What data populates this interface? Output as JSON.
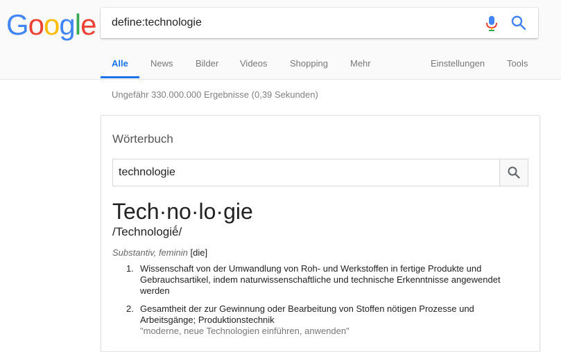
{
  "logo": {
    "letters": [
      "G",
      "o",
      "o",
      "g",
      "l",
      "e"
    ]
  },
  "search": {
    "query": "define:technologie"
  },
  "tabs": [
    {
      "label": "Alle",
      "active": true
    },
    {
      "label": "News"
    },
    {
      "label": "Bilder"
    },
    {
      "label": "Videos"
    },
    {
      "label": "Shopping"
    },
    {
      "label": "Mehr"
    },
    {
      "label": "Einstellungen"
    },
    {
      "label": "Tools"
    }
  ],
  "stats": "Ungefähr 330.000.000 Ergebnisse (0,39 Sekunden)",
  "dictionary": {
    "title": "Wörterbuch",
    "input_value": "technologie",
    "headword": "Tech·no·lo·gie",
    "phonetic": "/Technologiḗ/",
    "pos_type": "Substantiv, feminin",
    "article": "[die]",
    "definitions": [
      {
        "num": "1.",
        "text": "Wissenschaft von der Umwandlung von Roh- und Werkstoffen in fertige Produkte und Gebrauchsartikel, indem naturwissenschaftliche und technische Erkenntnisse angewendet werden"
      },
      {
        "num": "2.",
        "text": "Gesamtheit der zur Gewinnung oder Bearbeitung von Stoffen nötigen Prozesse und Arbeitsgänge; Produktionstechnik",
        "example": "\"moderne, neue Technologien einführen, anwenden\""
      }
    ]
  },
  "colors": {
    "accent_blue": "#1a73e8",
    "google_blue": "#4285f4",
    "google_red": "#ea4335",
    "google_yellow": "#fbbc05",
    "google_green": "#34a853"
  },
  "icons": [
    "microphone-icon",
    "search-icon",
    "dictionary-search-icon"
  ]
}
